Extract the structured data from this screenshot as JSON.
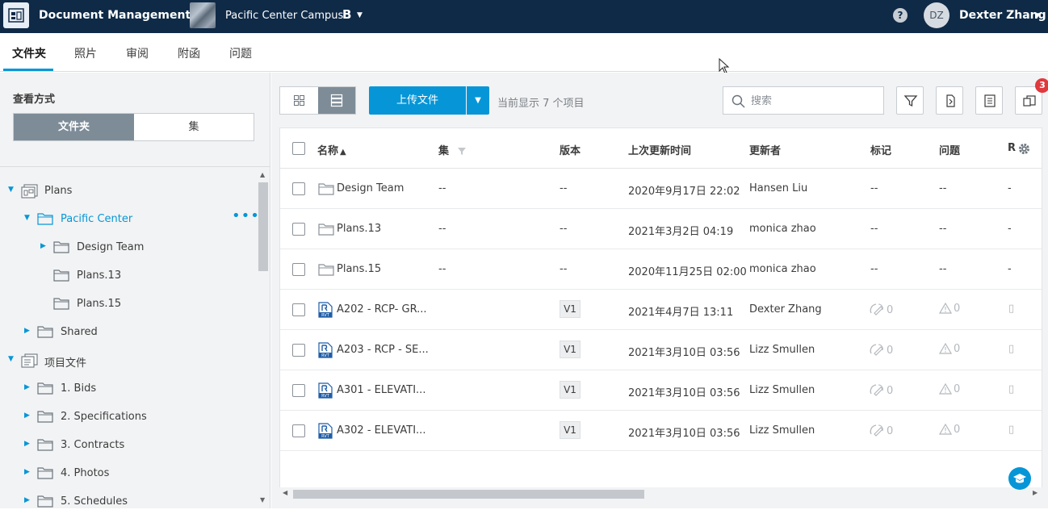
{
  "topbar": {
    "app_title": "Document Management",
    "project_name": "Pacific Center Campus",
    "project_badge": "B",
    "help": "?",
    "avatar_initials": "DZ",
    "user_name": "Dexter Zhang"
  },
  "tabs": [
    "文件夹",
    "照片",
    "审阅",
    "附函",
    "问题"
  ],
  "sidebar": {
    "view_label": "查看方式",
    "seg_folder": "文件夹",
    "seg_set": "集",
    "tree": [
      {
        "label": "Plans",
        "icon": "plans-folder-icon",
        "expanded": true
      },
      {
        "label": "Pacific Center",
        "icon": "folder-icon",
        "expanded": true,
        "selected": true
      },
      {
        "label": "Design Team",
        "icon": "folder-icon",
        "expanded": false
      },
      {
        "label": "Plans.13",
        "icon": "folder-icon"
      },
      {
        "label": "Plans.15",
        "icon": "folder-icon"
      },
      {
        "label": "Shared",
        "icon": "folder-icon",
        "expanded": false
      },
      {
        "label": "项目文件",
        "icon": "project-files-icon",
        "expanded": true
      },
      {
        "label": "1. Bids",
        "icon": "folder-icon",
        "expanded": false
      },
      {
        "label": "2. Specifications",
        "icon": "folder-icon",
        "expanded": false
      },
      {
        "label": "3. Contracts",
        "icon": "folder-icon",
        "expanded": false
      },
      {
        "label": "4. Photos",
        "icon": "folder-icon",
        "expanded": false
      },
      {
        "label": "5. Schedules",
        "icon": "folder-icon",
        "expanded": false
      }
    ],
    "more": "•••"
  },
  "toolbar": {
    "upload_label": "上传文件",
    "count_text": "当前显示 7 个项目",
    "search_placeholder": "搜索",
    "notification_count": "3"
  },
  "table": {
    "headers": {
      "name": "名称",
      "set": "集",
      "version": "版本",
      "updated": "上次更新时间",
      "updater": "更新者",
      "markups": "标记",
      "issues": "问题",
      "rfis": "R"
    },
    "rows": [
      {
        "type": "folder",
        "name": "Design Team",
        "set": "--",
        "version": "--",
        "updated": "2020年9月17日 22:02",
        "updater": "Hansen Liu",
        "markups": "--",
        "issues": "--",
        "rfi": "-"
      },
      {
        "type": "folder",
        "name": "Plans.13",
        "set": "--",
        "version": "--",
        "updated": "2021年3月2日 04:19",
        "updater": "monica zhao",
        "markups": "--",
        "issues": "--",
        "rfi": "-"
      },
      {
        "type": "folder",
        "name": "Plans.15",
        "set": "--",
        "version": "--",
        "updated": "2020年11月25日 02:00",
        "updater": "monica zhao",
        "markups": "--",
        "issues": "--",
        "rfi": "-"
      },
      {
        "type": "file",
        "name": "A202 - RCP- GR...",
        "set": "",
        "version": "V1",
        "updated": "2021年4月7日 13:11",
        "updater": "Dexter Zhang",
        "markups": "0",
        "issues": "0",
        "rfi": ""
      },
      {
        "type": "file",
        "name": "A203 - RCP - SE...",
        "set": "",
        "version": "V1",
        "updated": "2021年3月10日 03:56",
        "updater": "Lizz Smullen",
        "markups": "0",
        "issues": "0",
        "rfi": ""
      },
      {
        "type": "file",
        "name": "A301 - ELEVATI...",
        "set": "",
        "version": "V1",
        "updated": "2021年3月10日 03:56",
        "updater": "Lizz Smullen",
        "markups": "0",
        "issues": "0",
        "rfi": ""
      },
      {
        "type": "file",
        "name": "A302 - ELEVATI...",
        "set": "",
        "version": "V1",
        "updated": "2021年3月10日 03:56",
        "updater": "Lizz Smullen",
        "markups": "0",
        "issues": "0",
        "rfi": ""
      }
    ]
  },
  "colors": {
    "topbar": "#0f2a47",
    "accent": "#0696d7",
    "segment_active": "#7e8c98",
    "badge": "#e0393e"
  }
}
